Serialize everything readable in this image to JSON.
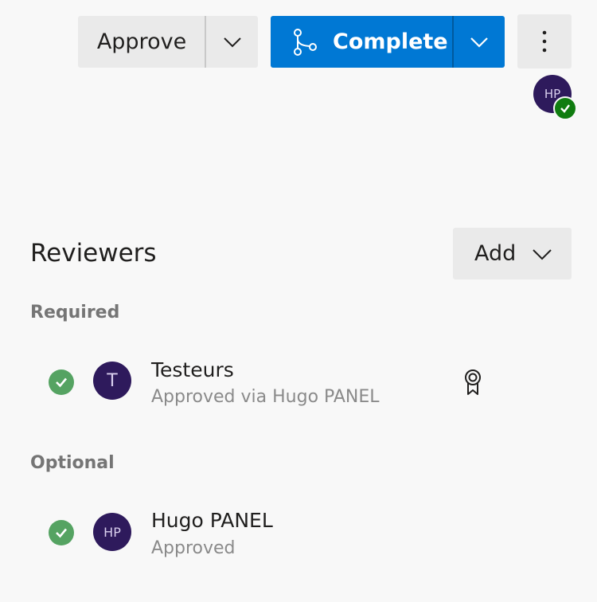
{
  "toolbar": {
    "approve_label": "Approve",
    "complete_label": "Complete",
    "accent_color": "#0078d4"
  },
  "header": {
    "avatar_initials": "HP",
    "avatar_status": "approved"
  },
  "reviewers": {
    "title": "Reviewers",
    "add_label": "Add",
    "sections": [
      {
        "label": "Required",
        "items": [
          {
            "name": "Testeurs",
            "status": "Approved via Hugo PANEL",
            "initials": "T",
            "icon": "award-ribbon-icon"
          }
        ]
      },
      {
        "label": "Optional",
        "items": [
          {
            "name": "Hugo PANEL",
            "status": "Approved",
            "initials": "HP"
          }
        ]
      }
    ]
  },
  "icons": {
    "status": "check-circle-icon",
    "branch": "branch-merge-icon",
    "more": "more-vertical-icon"
  }
}
